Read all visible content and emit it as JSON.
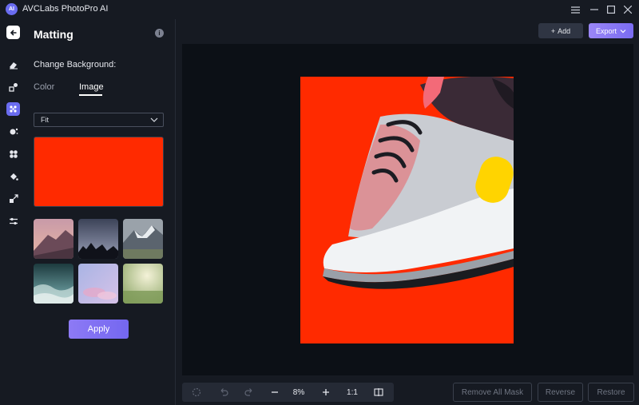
{
  "app": {
    "logo_text": "AI",
    "title": "AVCLabs PhotoPro AI"
  },
  "window": {
    "menu_icon": "hamburger-icon",
    "minimize_icon": "minimize-icon",
    "maximize_icon": "maximize-icon",
    "close_icon": "close-icon"
  },
  "rail": {
    "items": [
      {
        "name": "back-icon"
      },
      {
        "name": "eraser-icon"
      },
      {
        "name": "shapes-icon"
      },
      {
        "name": "matting-icon",
        "active": true
      },
      {
        "name": "enhance-icon"
      },
      {
        "name": "colorize-icon"
      },
      {
        "name": "fill-icon"
      },
      {
        "name": "upscale-icon"
      },
      {
        "name": "adjust-icon"
      }
    ]
  },
  "panel": {
    "title": "Matting",
    "info_icon": "i",
    "section_label": "Change Background:",
    "tabs": {
      "color": "Color",
      "image": "Image",
      "active": "Image"
    },
    "fit_select": {
      "value": "Fit"
    },
    "preview_color": "#ff2a00",
    "thumbnails": [
      {
        "name": "thumb-mountain-sunset"
      },
      {
        "name": "thumb-dusk-trees"
      },
      {
        "name": "thumb-snowy-mountains"
      },
      {
        "name": "thumb-ocean-wave"
      },
      {
        "name": "thumb-pastel-clouds"
      },
      {
        "name": "thumb-green-meadow"
      }
    ],
    "apply_label": "Apply"
  },
  "header": {
    "add_label": "Add",
    "add_icon": "+",
    "export_label": "Export"
  },
  "bottom": {
    "zoom": "8%",
    "ratio": "1:1",
    "remove_all_mask_label": "Remove All Mask",
    "reverse_label": "Reverse",
    "restore_label": "Restore"
  },
  "colors": {
    "accent": "#6a6cf0",
    "background": "#161a22",
    "canvas": "#0c1016",
    "photo_bg": "#ff2a00",
    "shoe_accent": "#ffd400"
  }
}
